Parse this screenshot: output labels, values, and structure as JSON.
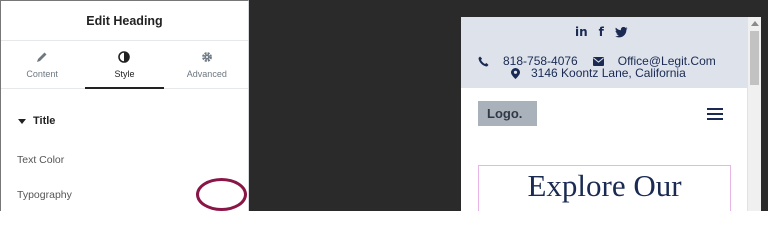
{
  "panel": {
    "title": "Edit Heading",
    "tabs": [
      {
        "label": "Content",
        "icon": "pencil-icon",
        "active": false
      },
      {
        "label": "Style",
        "icon": "half-circle-icon",
        "active": true
      },
      {
        "label": "Advanced",
        "icon": "gear-icon",
        "active": false
      }
    ],
    "section_title": "Title",
    "text_color_label": "Text Color",
    "typography_label": "Typography",
    "accent_color": "#1a2a52",
    "highlight_color": "#8a1547"
  },
  "preview": {
    "social_icons": [
      {
        "name": "linkedin-icon",
        "glyph": "in"
      },
      {
        "name": "facebook-icon",
        "glyph": "f"
      },
      {
        "name": "twitter-icon",
        "glyph": "𝕥"
      }
    ],
    "phone": "818-758-4076",
    "email": "Office@Legit.Com",
    "address": "3146 Koontz Lane, California",
    "logo": "Logo.",
    "heading": "Explore Our"
  }
}
